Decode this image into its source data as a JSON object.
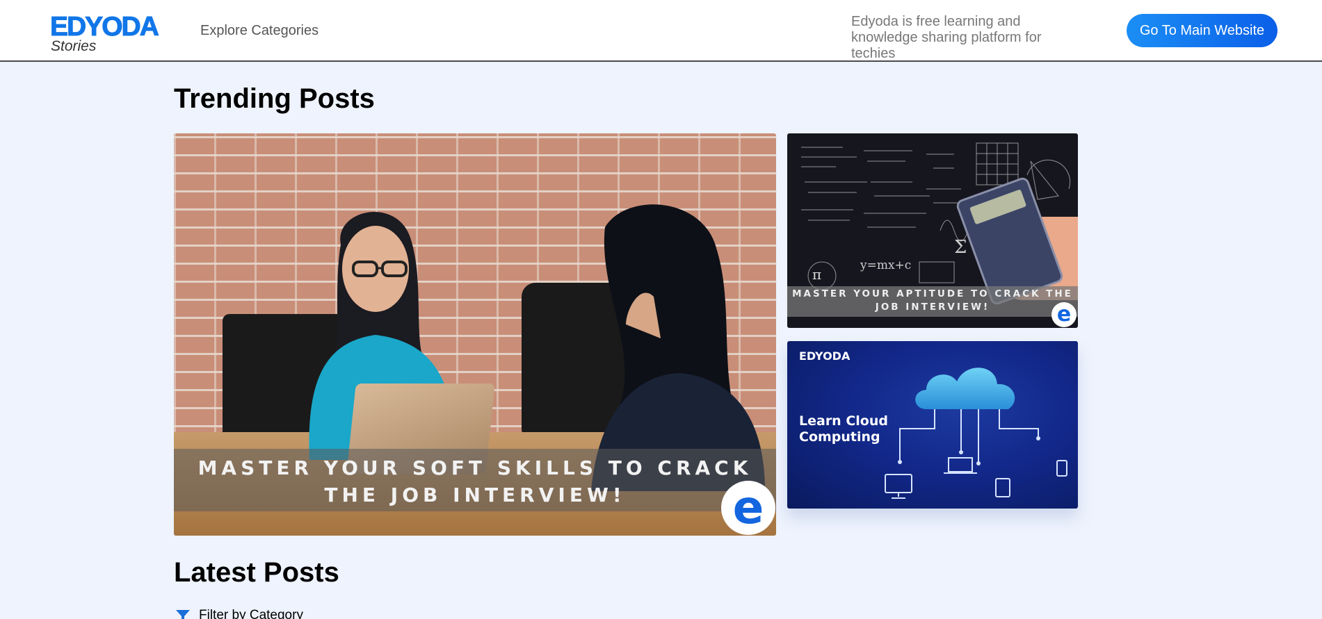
{
  "header": {
    "logo_main": "EDYODA",
    "logo_sub": "Stories",
    "nav_explore": "Explore Categories",
    "tagline": "Edyoda is free learning and knowledge sharing platform for techies",
    "main_button": "Go To Main Website",
    "accent_color": "#1176e8"
  },
  "trending": {
    "title": "Trending Posts",
    "posts": [
      {
        "banner": "MASTER YOUR SOFT SKILLS TO CRACK THE JOB INTERVIEW!",
        "badge_icon": "edyoda-e-icon"
      },
      {
        "banner": "MASTER YOUR APTITUDE TO CRACK THE JOB INTERVIEW!",
        "badge_icon": "edyoda-e-icon"
      },
      {
        "brand": "EDYODA",
        "title": "Learn Cloud Computing",
        "icon": "cloud-network-icon"
      }
    ]
  },
  "latest": {
    "title": "Latest Posts",
    "filter_label": "Filter by Category",
    "filter_icon": "funnel-icon"
  }
}
